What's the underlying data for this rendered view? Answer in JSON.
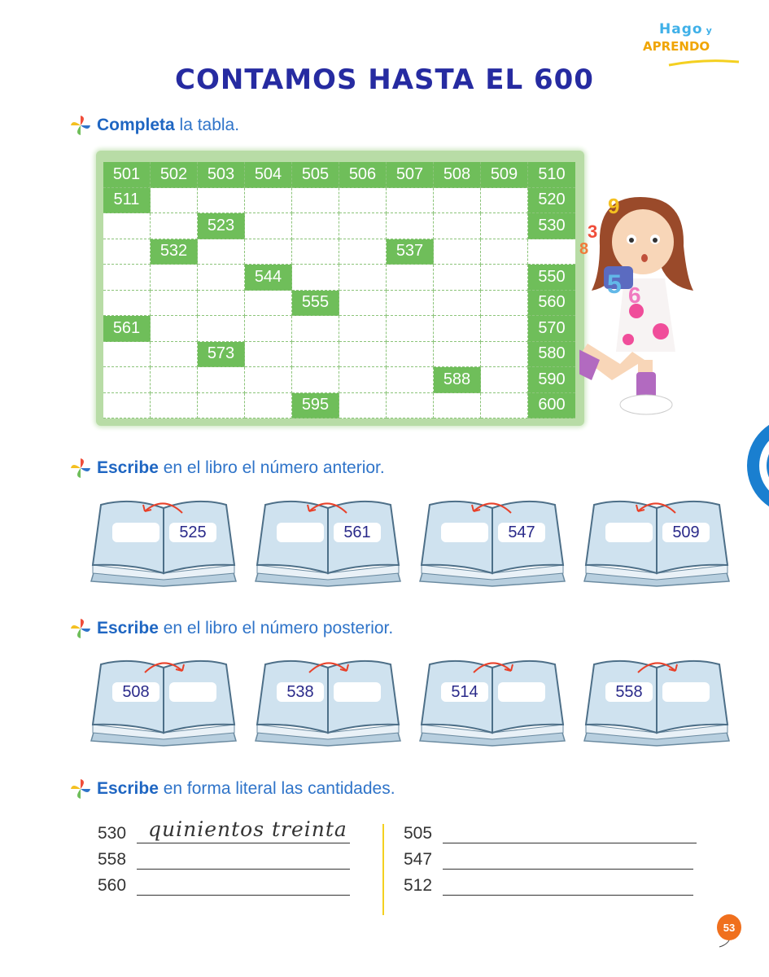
{
  "logo": {
    "line1": "Hago",
    "line1_small": "y",
    "line2": "APRENDO"
  },
  "title": "CONTAMOS HASTA EL 600",
  "instructions": [
    {
      "bold": "Completa",
      "rest": " la tabla."
    },
    {
      "bold": "Escribe",
      "rest": " en el libro el número anterior."
    },
    {
      "bold": "Escribe",
      "rest": " en el libro el número posterior."
    },
    {
      "bold": "Escribe",
      "rest": " en forma literal las cantidades."
    }
  ],
  "table": {
    "rows": [
      [
        "501",
        "502",
        "503",
        "504",
        "505",
        "506",
        "507",
        "508",
        "509",
        "510"
      ],
      [
        "511",
        "",
        "",
        "",
        "",
        "",
        "",
        "",
        "",
        "520"
      ],
      [
        "",
        "",
        "523",
        "",
        "",
        "",
        "",
        "",
        "",
        "530"
      ],
      [
        "",
        "532",
        "",
        "",
        "",
        "",
        "537",
        "",
        "",
        ""
      ],
      [
        "",
        "",
        "",
        "544",
        "",
        "",
        "",
        "",
        "",
        "550"
      ],
      [
        "",
        "",
        "",
        "",
        "555",
        "",
        "",
        "",
        "",
        "560"
      ],
      [
        "561",
        "",
        "",
        "",
        "",
        "",
        "",
        "",
        "",
        "570"
      ],
      [
        "",
        "",
        "573",
        "",
        "",
        "",
        "",
        "",
        "",
        "580"
      ],
      [
        "",
        "",
        "",
        "",
        "",
        "",
        "",
        "588",
        "",
        "590"
      ],
      [
        "",
        "",
        "",
        "",
        "595",
        "",
        "",
        "",
        "",
        "600"
      ]
    ]
  },
  "books_before": [
    "525",
    "561",
    "547",
    "509"
  ],
  "books_after": [
    "508",
    "538",
    "514",
    "558"
  ],
  "literal": {
    "left": [
      {
        "number": "530",
        "answer": "quinientos treinta"
      },
      {
        "number": "558",
        "answer": ""
      },
      {
        "number": "560",
        "answer": ""
      }
    ],
    "right": [
      {
        "number": "505",
        "answer": ""
      },
      {
        "number": "547",
        "answer": ""
      },
      {
        "number": "512",
        "answer": ""
      }
    ]
  },
  "page_number": "53",
  "colors": {
    "title": "#262ba1",
    "instruction": "#2f74c9",
    "grid_fill": "#6fbe5a",
    "book": "#cfe2ef"
  }
}
